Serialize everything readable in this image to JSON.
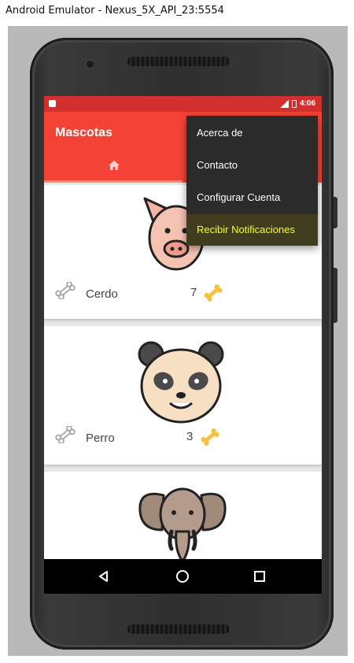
{
  "window": {
    "title": "Android Emulator - Nexus_5X_API_23:5554"
  },
  "status_bar": {
    "time": "4:06"
  },
  "app_bar": {
    "title": "Mascotas",
    "tab_icon": "home-icon"
  },
  "overflow_menu": {
    "items": [
      {
        "label": "Acerca de"
      },
      {
        "label": "Contacto"
      },
      {
        "label": "Configurar Cuenta"
      },
      {
        "label": "Recibir Notificaciones",
        "highlighted": true
      }
    ]
  },
  "pets": [
    {
      "name": "Cerdo",
      "count": "7",
      "image": "pig-icon"
    },
    {
      "name": "Perro",
      "count": "3",
      "image": "panda-icon"
    },
    {
      "name": "",
      "count": "",
      "image": "elephant-icon"
    }
  ],
  "nav_bar": {
    "back": "back-triangle-icon",
    "home": "home-circle-icon",
    "recents": "recents-square-icon"
  },
  "colors": {
    "status_bar": "#d32f2f",
    "app_bar": "#f44336",
    "menu_bg": "#2b2b2b",
    "menu_highlight_text": "#ffff00",
    "bone": "#f5c242"
  }
}
